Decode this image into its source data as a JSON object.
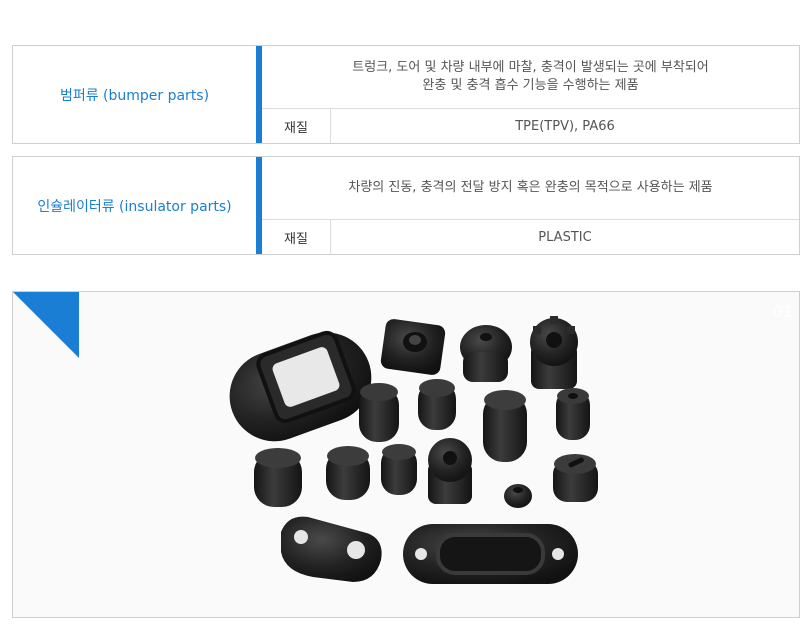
{
  "spec1": {
    "category": "범퍼류 (bumper parts)",
    "desc_line1": "트렁크, 도어 및 차량 내부에 마찰, 충격이 발생되는 곳에 부착되어",
    "desc_line2": "완충 및 충격 흡수 기능을 수행하는 제품",
    "material_label": "재질",
    "material_value": "TPE(TPV), PA66"
  },
  "spec2": {
    "category": "인슐레이터류 (insulator parts)",
    "desc_line1": "차량의 진동, 충격의 전달 방지 혹은 완충의 목적으로 사용하는 제품",
    "material_label": "재질",
    "material_value": "PLASTIC"
  },
  "photo": {
    "badge": "01",
    "accent": "#1a7fd4"
  }
}
